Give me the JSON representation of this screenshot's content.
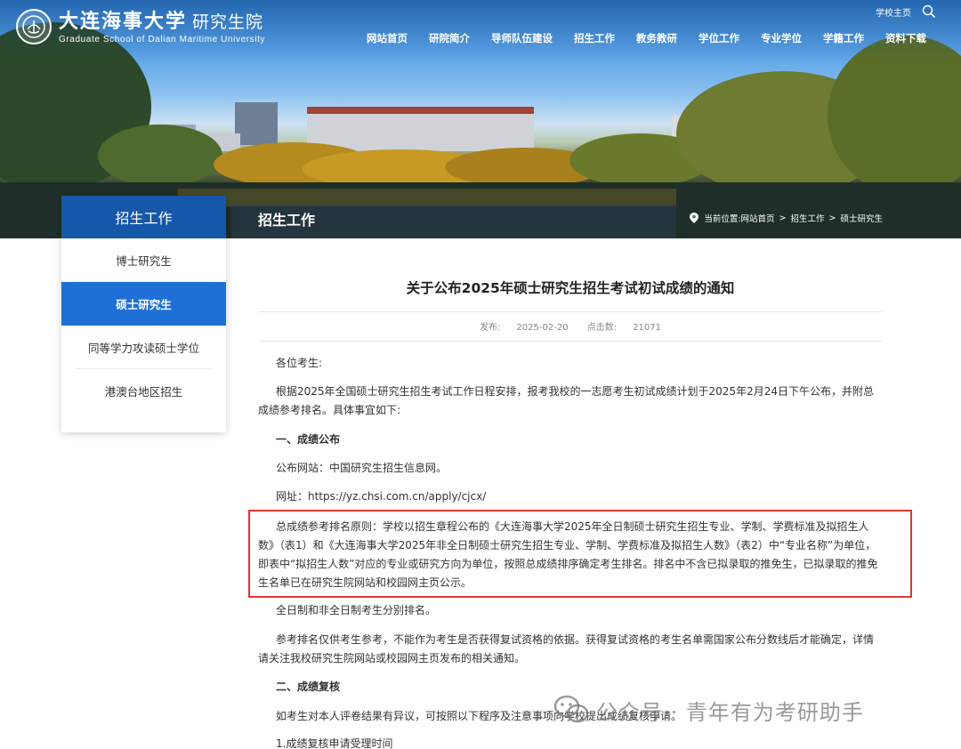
{
  "header": {
    "logo_cn": "大连海事大学",
    "logo_sub": "研究生院",
    "logo_en": "Graduate School of Dalian Maritime University",
    "home_link": "学校主页",
    "nav": [
      "网站首页",
      "研院简介",
      "导师队伍建设",
      "招生工作",
      "教务教研",
      "学位工作",
      "专业学位",
      "学籍工作",
      "资料下载"
    ]
  },
  "section_title": "招生工作",
  "breadcrumb": {
    "prefix": "当前位置:",
    "items": [
      "网站首页",
      "招生工作",
      "硕士研究生"
    ],
    "separator": ">"
  },
  "sidebar": {
    "title": "招生工作",
    "items": [
      {
        "label": "博士研究生",
        "active": false
      },
      {
        "label": "硕士研究生",
        "active": true
      },
      {
        "label": "同等学力攻读硕士学位",
        "active": false
      },
      {
        "label": "港澳台地区招生",
        "active": false
      }
    ]
  },
  "article": {
    "title": "关于公布2025年硕士研究生招生考试初试成绩的通知",
    "publish_label": "发布:",
    "publish_date": "2025-02-20",
    "clicks_label": "点击数:",
    "clicks": "21071",
    "paragraphs": [
      "各位考生:",
      "根据2025年全国硕士研究生招生考试工作日程安排，报考我校的一志愿考生初试成绩计划于2025年2月24日下午公布，并附总成绩参考排名。具体事宜如下:",
      "一、成绩公布",
      "公布网站：中国研究生招生信息网。",
      "网址：https://yz.chsi.com.cn/apply/cjcx/",
      "总成绩参考排名原则：学校以招生章程公布的《大连海事大学2025年全日制硕士研究生招生专业、学制、学费标准及拟招生人数》（表1）和《大连海事大学2025年非全日制硕士研究生招生专业、学制、学费标准及拟招生人数》（表2）中“专业名称”为单位，即表中“拟招生人数”对应的专业或研究方向为单位，按照总成绩排序确定考生排名。排名中不含已拟录取的推免生，已拟录取的推免生名单已在研究生院网站和校园网主页公示。",
      "全日制和非全日制考生分别排名。",
      "参考排名仅供考生参考，不能作为考生是否获得复试资格的依据。获得复试资格的考生名单需国家公布分数线后才能确定，详情请关注我校研究生院网站或校园网主页发布的相关通知。",
      "二、成绩复核",
      "如考生对本人评卷结果有异议，可按照以下程序及注意事项向学校提出成绩复核申请。",
      "1.成绩复核申请受理时间"
    ]
  },
  "watermark": "公众号 · 青年有为考研助手",
  "colors": {
    "accent": "#1557a8",
    "active": "#1e70d6",
    "highlight": "#e0382f"
  }
}
